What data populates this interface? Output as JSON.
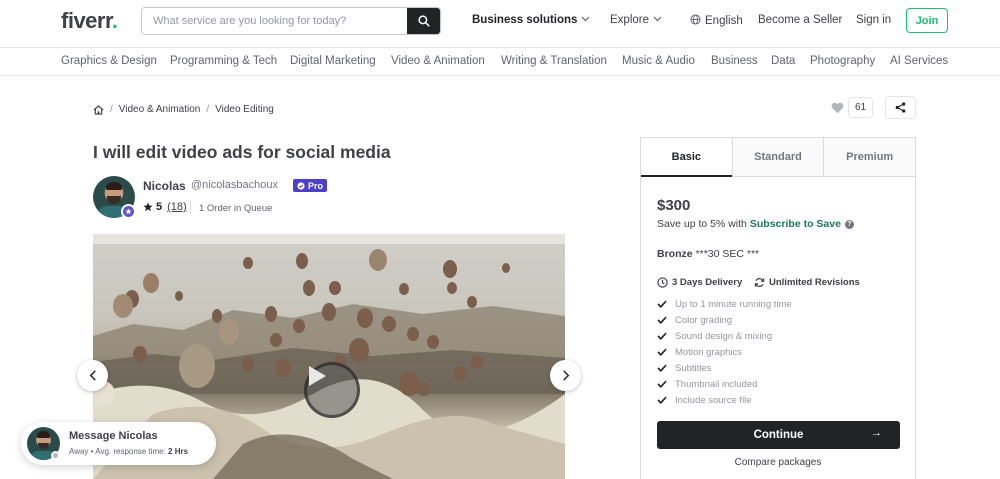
{
  "header": {
    "logo_text": "fiverr",
    "logo_dot": ".",
    "search_placeholder": "What service are you looking for today?",
    "nav": {
      "business_solutions": "Business solutions",
      "explore": "Explore",
      "language": "English",
      "become_seller": "Become a Seller",
      "sign_in": "Sign in",
      "join": "Join"
    }
  },
  "categories": [
    "Graphics & Design",
    "Programming & Tech",
    "Digital Marketing",
    "Video & Animation",
    "Writing & Translation",
    "Music & Audio",
    "Business",
    "Data",
    "Photography",
    "AI Services"
  ],
  "breadcrumb": {
    "items": [
      "Video & Animation",
      "Video Editing"
    ],
    "separator": "/"
  },
  "favorites_count": "61",
  "gig": {
    "title": "I will edit video ads for social media"
  },
  "seller": {
    "name": "Nicolas",
    "handle": "@nicolasbachoux",
    "pro_label": "Pro",
    "rating": "5",
    "review_count": "(18)",
    "queue": "1 Order in Queue"
  },
  "message": {
    "title": "Message Nicolas",
    "status": "Away",
    "bullet": "•",
    "response_label": "Avg. response time:",
    "response_value": "2 Hrs"
  },
  "packages": {
    "tabs": [
      "Basic",
      "Standard",
      "Premium"
    ],
    "active_tab": "Basic",
    "price": "$300",
    "save_text": "Save up to 5% with",
    "save_link": "Subscribe to Save",
    "help_glyph": "?",
    "package_name": "Bronze",
    "package_desc": "***30 SEC ***",
    "delivery": "3 Days Delivery",
    "revisions": "Unlimited Revisions",
    "features": [
      "Up to 1 minute running time",
      "Color grading",
      "Sound design & mixing",
      "Motion graphics",
      "Subtitles",
      "Thumbnail included",
      "Include source file"
    ],
    "continue_label": "Continue",
    "continue_arrow": "→",
    "compare_label": "Compare packages"
  },
  "colors": {
    "brand_green": "#1dbf73",
    "pro_purple": "#4e3fc9",
    "dark": "#222325",
    "subscribe_link": "#1a7a5a"
  }
}
